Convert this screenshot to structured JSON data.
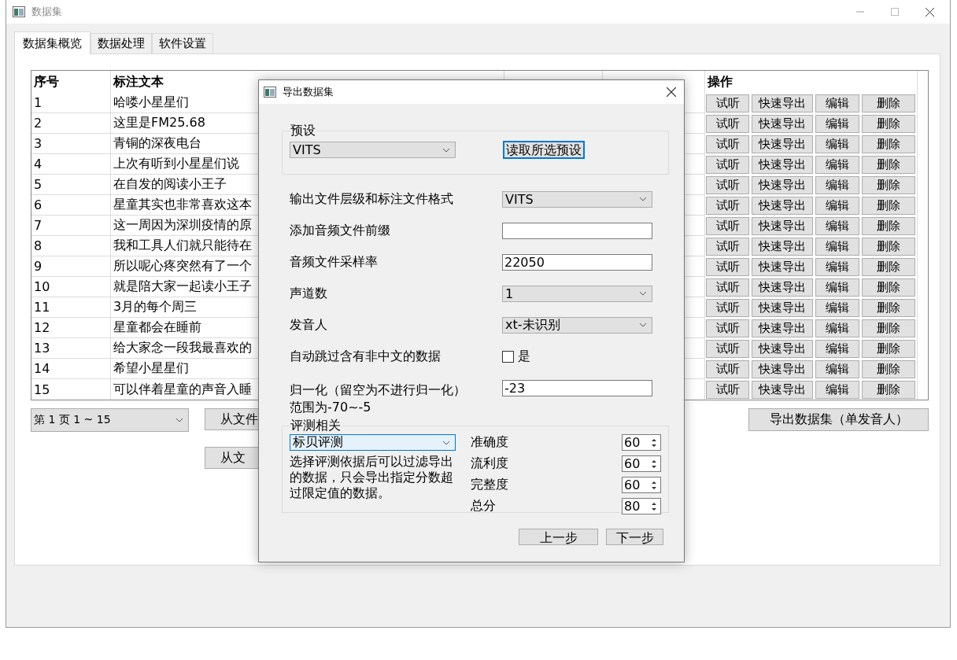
{
  "window": {
    "title": "数据集"
  },
  "tabs": [
    {
      "label": "数据集概览",
      "selected": true
    },
    {
      "label": "数据处理",
      "selected": false
    },
    {
      "label": "软件设置",
      "selected": false
    }
  ],
  "table": {
    "columns": [
      "序号",
      "标注文本"
    ],
    "action_column": "操作",
    "rows": [
      {
        "index": "1",
        "text": "哈喽小星星们",
        "actions": [
          "试听",
          "快速导出",
          "编辑",
          "删除"
        ]
      },
      {
        "index": "2",
        "text": "这里是FM25.68",
        "actions": [
          "试听",
          "快速导出",
          "编辑",
          "删除"
        ]
      },
      {
        "index": "3",
        "text": "青铜的深夜电台",
        "actions": [
          "试听",
          "快速导出",
          "编辑",
          "删除"
        ]
      },
      {
        "index": "4",
        "text": "上次有听到小星星们说",
        "actions": [
          "试听",
          "快速导出",
          "编辑",
          "删除"
        ]
      },
      {
        "index": "5",
        "text": "在自发的阅读小王子",
        "actions": [
          "试听",
          "快速导出",
          "编辑",
          "删除"
        ]
      },
      {
        "index": "6",
        "text": "星童其实也非常喜欢这本",
        "actions": [
          "试听",
          "快速导出",
          "编辑",
          "删除"
        ]
      },
      {
        "index": "7",
        "text": "这一周因为深圳疫情的原",
        "actions": [
          "试听",
          "快速导出",
          "编辑",
          "删除"
        ]
      },
      {
        "index": "8",
        "text": "我和工具人们就只能待在",
        "actions": [
          "试听",
          "快速导出",
          "编辑",
          "删除"
        ]
      },
      {
        "index": "9",
        "text": "所以呢心疼突然有了一个",
        "actions": [
          "试听",
          "快速导出",
          "编辑",
          "删除"
        ]
      },
      {
        "index": "10",
        "text": "就是陪大家一起读小王子",
        "actions": [
          "试听",
          "快速导出",
          "编辑",
          "删除"
        ]
      },
      {
        "index": "11",
        "text": "3月的每个周三",
        "actions": [
          "试听",
          "快速导出",
          "编辑",
          "删除"
        ]
      },
      {
        "index": "12",
        "text": "星童都会在睡前",
        "actions": [
          "试听",
          "快速导出",
          "编辑",
          "删除"
        ]
      },
      {
        "index": "13",
        "text": "给大家念一段我最喜欢的",
        "actions": [
          "试听",
          "快速导出",
          "编辑",
          "删除"
        ]
      },
      {
        "index": "14",
        "text": "希望小星星们",
        "actions": [
          "试听",
          "快速导出",
          "编辑",
          "删除"
        ]
      },
      {
        "index": "15",
        "text": "可以伴着星童的声音入睡",
        "actions": [
          "试听",
          "快速导出",
          "编辑",
          "删除"
        ]
      }
    ]
  },
  "pager": {
    "value": "第 1 页  1 ~ 15"
  },
  "import_buttons": [
    "从文件",
    "从文"
  ],
  "export_button": "导出数据集（单发音人）",
  "dialog": {
    "title": "导出数据集",
    "preset": {
      "title": "预设",
      "value": "VITS",
      "button": "读取所选预设"
    },
    "fields": [
      {
        "kind": "select",
        "label": "输出文件层级和标注文件格式",
        "value": "VITS"
      },
      {
        "kind": "input",
        "label": "添加音频文件前缀"
      },
      {
        "kind": "input",
        "label": "音频文件采样率",
        "value": "22050"
      },
      {
        "kind": "select",
        "label": "声道数",
        "value": "1"
      },
      {
        "kind": "select",
        "label": "发音人",
        "value": "xt-未识别"
      },
      {
        "kind": "checkbox",
        "label": "自动跳过含有非中文的数据",
        "option": "是",
        "checked": false
      },
      {
        "kind": "input",
        "label": "归一化（留空为不进行归一化）",
        "note": "范围为-70~-5",
        "value": "-23"
      }
    ],
    "evaluation": {
      "title": "评测相关",
      "method": "标贝评测",
      "description": "选择评测依据后可以过滤导出的数据，只会导出指定分数超过限定值的数据。",
      "scores": [
        {
          "label": "准确度",
          "value": "60"
        },
        {
          "label": "流利度",
          "value": "60"
        },
        {
          "label": "完整度",
          "value": "60"
        },
        {
          "label": "总分",
          "value": "80"
        }
      ]
    },
    "buttons": [
      "上一步",
      "下一步"
    ]
  }
}
